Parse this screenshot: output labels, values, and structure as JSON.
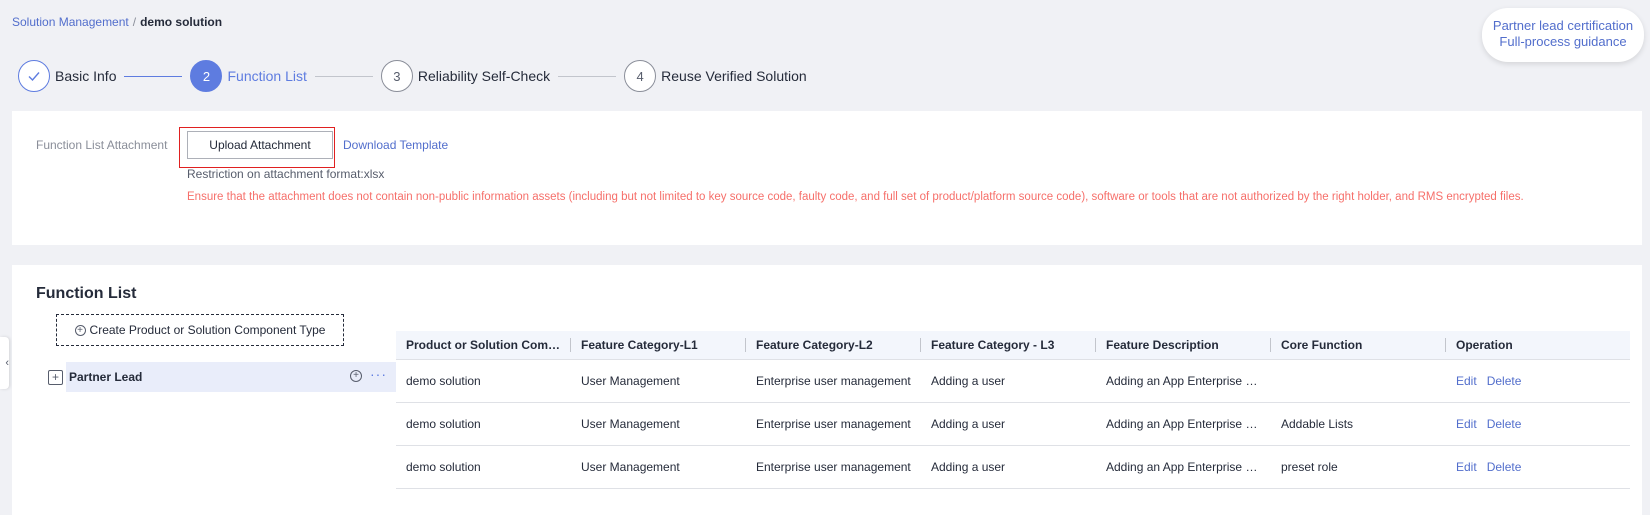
{
  "breadcrumb": {
    "parent": "Solution Management",
    "separator": "/",
    "current": "demo solution"
  },
  "guide": {
    "line1": "Partner lead certification",
    "line2": "Full-process guidance"
  },
  "steps": [
    {
      "number": "",
      "label": "Basic Info",
      "state": "done"
    },
    {
      "number": "2",
      "label": "Function List",
      "state": "active"
    },
    {
      "number": "3",
      "label": "Reliability Self-Check",
      "state": "pending"
    },
    {
      "number": "4",
      "label": "Reuse Verified Solution",
      "state": "pending"
    }
  ],
  "upload": {
    "label": "Function List Attachment",
    "button": "Upload Attachment",
    "download_link": "Download Template",
    "restriction": "Restriction on attachment format:xlsx",
    "warning": "Ensure that the attachment does not contain non-public information assets (including but not limited to key source code, faulty code, and full set of product/platform source code), software or tools that are not authorized by the right holder, and RMS encrypted files."
  },
  "function_list": {
    "title": "Function List",
    "create_button": "Create Product or Solution Component Type",
    "tree": {
      "node_label": "Partner Lead",
      "expand_symbol": "+",
      "more_symbol": "···"
    },
    "table": {
      "headers": [
        "Product or Solution Comp...",
        "Feature Category-L1",
        "Feature Category-L2",
        "Feature Category - L3",
        "Feature Description",
        "Core Function",
        "Operation"
      ],
      "rows": [
        [
          "demo solution",
          "User Management",
          "Enterprise user management",
          "Adding a user",
          "Adding an App Enterprise U...",
          ""
        ],
        [
          "demo solution",
          "User Management",
          "Enterprise user management",
          "Adding a user",
          "Adding an App Enterprise U...",
          "Addable Lists"
        ],
        [
          "demo solution",
          "User Management",
          "Enterprise user management",
          "Adding a user",
          "Adding an App Enterprise U...",
          "preset role"
        ]
      ],
      "operations": {
        "edit": "Edit",
        "delete": "Delete"
      }
    }
  },
  "colors": {
    "accent": "#5e7ce0",
    "link": "#526ecc",
    "warning": "#f66f6a",
    "highlight_border": "#e02020",
    "page_bg": "#f0f1f5"
  },
  "icons": {
    "step-done": "check-icon",
    "create": "plus-circle-icon",
    "tree-add": "plus-circle-icon",
    "tree-expand": "expand-icon",
    "tree-more": "more-icon",
    "side-tab": "chevron-left-icon"
  }
}
